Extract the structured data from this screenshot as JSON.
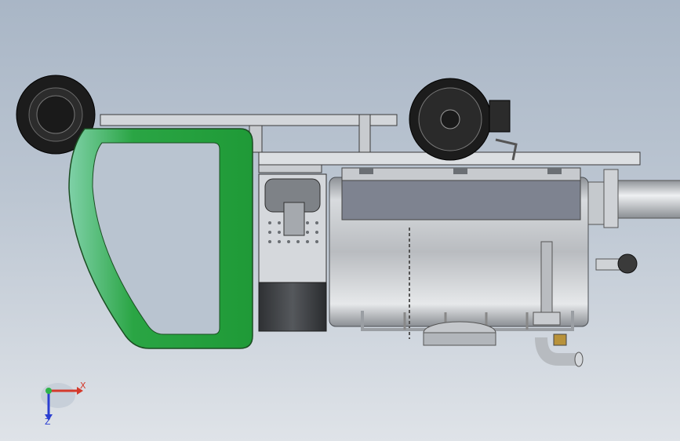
{
  "viewport": {
    "background_top": "#a9b6c6",
    "background_bottom": "#dfe3e8"
  },
  "model": {
    "cab_color": "#22a03a",
    "cab_highlight": "#7fd1a8",
    "body_color": "#cfd3d8",
    "tire_color": "#1c1c1c"
  },
  "triad": {
    "x_label": "X",
    "z_label": "Z",
    "x_color": "#d43a2c",
    "z_color": "#2b3fd1",
    "y_color": "#2fb34a"
  }
}
